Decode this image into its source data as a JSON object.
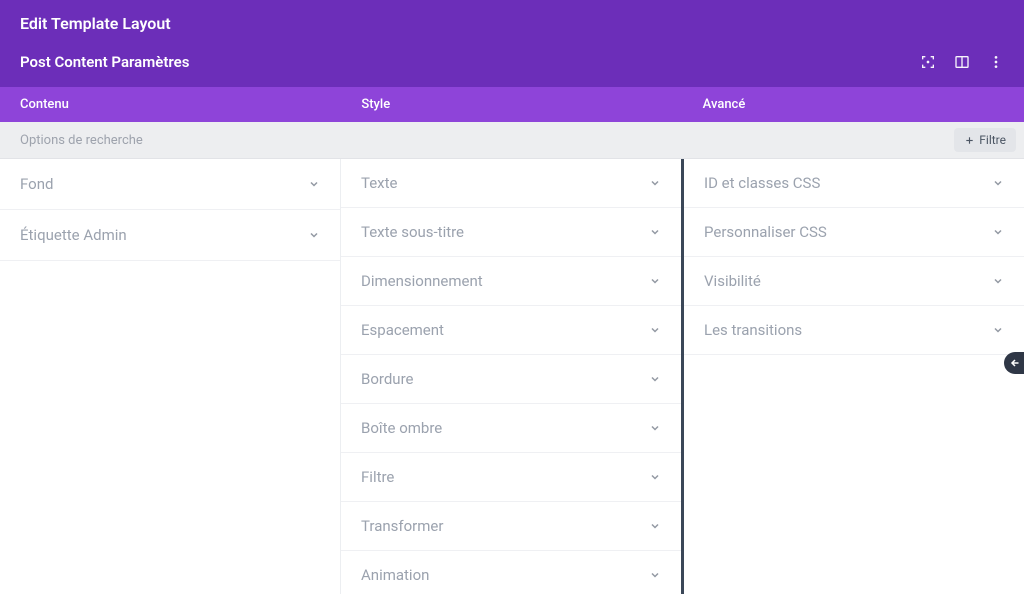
{
  "header": {
    "title": "Edit Template Layout",
    "subtitle": "Post Content Paramètres"
  },
  "tabs": {
    "content": "Contenu",
    "style": "Style",
    "advanced": "Avancé"
  },
  "search": {
    "placeholder": "Options de recherche",
    "filter_label": "Filtre"
  },
  "columns": {
    "content": {
      "items": [
        {
          "label": "Fond"
        },
        {
          "label": "Étiquette Admin"
        }
      ]
    },
    "style": {
      "items": [
        {
          "label": "Texte"
        },
        {
          "label": "Texte sous-titre"
        },
        {
          "label": "Dimensionnement"
        },
        {
          "label": "Espacement"
        },
        {
          "label": "Bordure"
        },
        {
          "label": "Boîte ombre"
        },
        {
          "label": "Filtre"
        },
        {
          "label": "Transformer"
        },
        {
          "label": "Animation"
        }
      ]
    },
    "advanced": {
      "items": [
        {
          "label": "ID et classes CSS"
        },
        {
          "label": "Personnaliser CSS"
        },
        {
          "label": "Visibilité"
        },
        {
          "label": "Les transitions"
        }
      ]
    }
  }
}
